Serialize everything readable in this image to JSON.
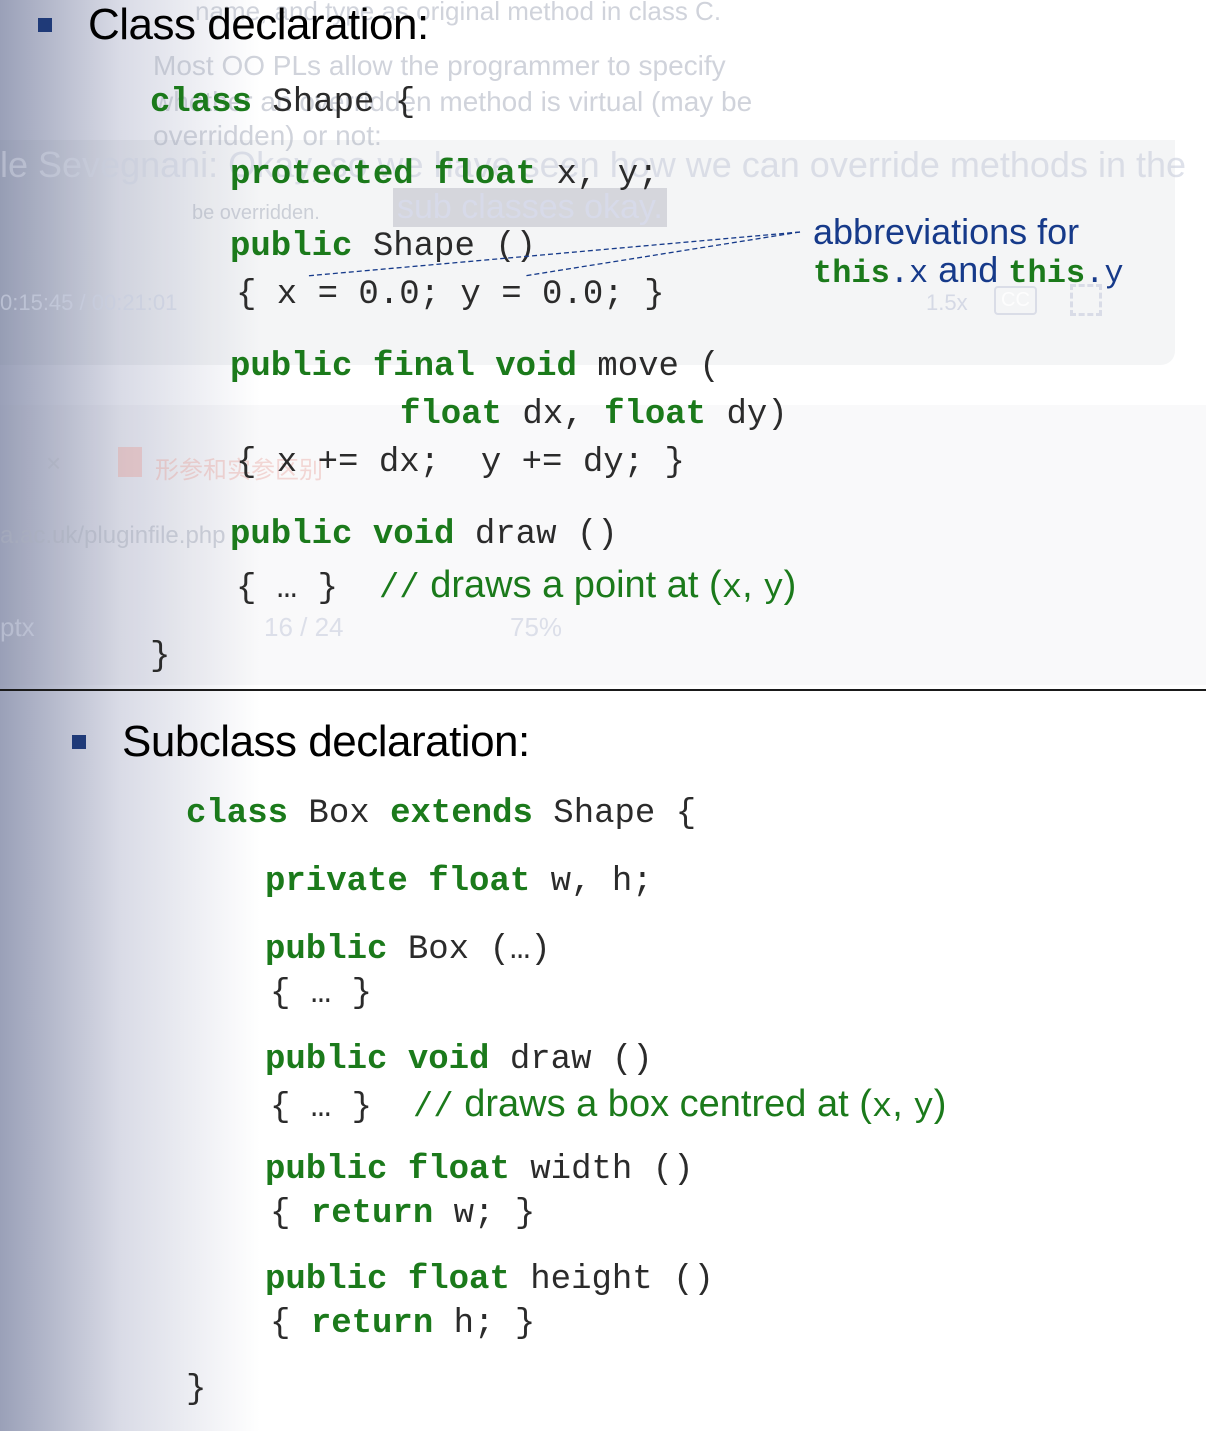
{
  "top_slide": {
    "heading": "Class declaration:",
    "code": {
      "line1_kw": "class",
      "line1_rest": " Shape {",
      "line2_kw1": "protected",
      "line2_kw2": "float",
      "line2_rest": " x, y;",
      "line3_kw": "public",
      "line3_rest": " Shape ()",
      "line4": "{ x = 0.0; y = 0.0; }",
      "line5_kw1": "public",
      "line5_kw2": "final",
      "line5_kw3": "void",
      "line5_rest": " move (",
      "line6_kw1": "float",
      "line6_mid": " dx, ",
      "line6_kw2": "float",
      "line6_rest": " dy)",
      "line7": "{ x += dx;  y += dy; }",
      "line8_kw1": "public",
      "line8_kw2": "void",
      "line8_rest": " draw ()",
      "line9_braces": "{ … }  ",
      "line9_slashes": "//",
      "line9_comment_a": " draws a point at (",
      "line9_x": "x",
      "line9_comment_b": ", ",
      "line9_y": "y",
      "line9_comment_c": ")",
      "closing": "}"
    },
    "annotation": {
      "line1": "abbreviations for",
      "this1": "this",
      "dotx": ".x",
      "and": " and ",
      "this2": "this",
      "doty": ".y"
    }
  },
  "overlay_ghosts": {
    "t1": "name, and type as original method in class C.",
    "t2": "Most OO PLs allow the programmer to specify",
    "t3": "whether an overridden method is virtual (may be",
    "t4": "overridden) or not:",
    "caption1": "le Sevegnani: Okay, so we have seen how we can override methods in the",
    "caption2": "sub classes okay.",
    "t5": "be overridden.",
    "time": "0:15:45 / 00:21:01",
    "speed": "1.5x",
    "cc": "CC",
    "tab": "形参和实参区别",
    "url": "a.ac.uk/pluginfile.php",
    "ext": "ptx",
    "page": "16  /  24",
    "zoom": "75%"
  },
  "bottom_slide": {
    "heading": "Subclass declaration:",
    "code": {
      "l1_kw1": "class",
      "l1_mid": " Box ",
      "l1_kw2": "extends",
      "l1_rest": " Shape {",
      "l2_kw1": "private",
      "l2_kw2": "float",
      "l2_rest": " w, h;",
      "l3_kw": "public",
      "l3_rest": " Box (…)",
      "l4": "{ … }",
      "l5_kw1": "public",
      "l5_kw2": "void",
      "l5_rest": " draw ()",
      "l6_braces": "{ … }  ",
      "l6_slashes": "//",
      "l6_comment_a": " draws a box centred at (",
      "l6_x": "x",
      "l6_comment_b": ", ",
      "l6_y": "y",
      "l6_comment_c": ")",
      "l7_kw1": "public",
      "l7_kw2": "float",
      "l7_rest": " width ()",
      "l8_open": "{ ",
      "l8_kw": "return",
      "l8_rest": " w; }",
      "l9_kw1": "public",
      "l9_kw2": "float",
      "l9_rest": " height ()",
      "l10_open": "{ ",
      "l10_kw": "return",
      "l10_rest": " h; }",
      "closing": "}"
    }
  },
  "colors": {
    "keyword": "#1b7a1b",
    "annotation": "#163a8a",
    "bullet": "#1f3a78"
  }
}
